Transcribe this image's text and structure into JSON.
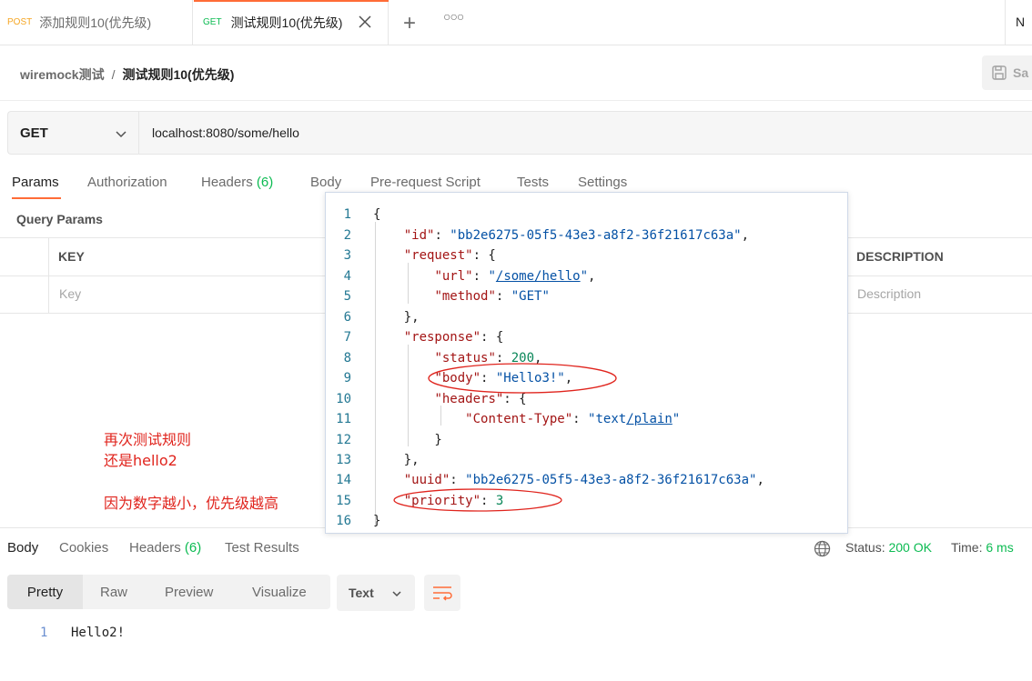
{
  "tabs": [
    {
      "method": "POST",
      "label": "添加规则10(优先级)"
    },
    {
      "method": "GET",
      "label": "测试规则10(优先级)"
    }
  ],
  "tab_right_letter": "N",
  "breadcrumb": {
    "parent": "wiremock测试",
    "separator": "/",
    "current": "测试规则10(优先级)"
  },
  "save_label": "Sa",
  "request": {
    "method": "GET",
    "url": "localhost:8080/some/hello"
  },
  "request_tabs": {
    "params": "Params",
    "authorization": "Authorization",
    "headers": "Headers",
    "headers_count": "(6)",
    "body": "Body",
    "prerequest": "Pre-request Script",
    "tests": "Tests",
    "settings": "Settings"
  },
  "query_params": {
    "title": "Query Params",
    "col_key": "KEY",
    "col_desc": "DESCRIPTION",
    "key_placeholder": "Key",
    "desc_placeholder": "Description"
  },
  "annotation": {
    "line1": "再次测试规则",
    "line2": "还是hello2",
    "line3": "因为数字越小，优先级越高"
  },
  "code_lines": [
    {
      "n": "1"
    },
    {
      "n": "2"
    },
    {
      "n": "3"
    },
    {
      "n": "4"
    },
    {
      "n": "5"
    },
    {
      "n": "6"
    },
    {
      "n": "7"
    },
    {
      "n": "8"
    },
    {
      "n": "9"
    },
    {
      "n": "10"
    },
    {
      "n": "11"
    },
    {
      "n": "12"
    },
    {
      "n": "13"
    },
    {
      "n": "14"
    },
    {
      "n": "15"
    },
    {
      "n": "16"
    }
  ],
  "code": {
    "id_key": "\"id\"",
    "id_val": "\"bb2e6275-05f5-43e3-a8f2-36f21617c63a\"",
    "request_key": "\"request\"",
    "url_key": "\"url\"",
    "url_val_q1": "\"",
    "url_val": "/some/hello",
    "url_val_q2": "\"",
    "method_key": "\"method\"",
    "method_val": "\"GET\"",
    "response_key": "\"response\"",
    "status_key": "\"status\"",
    "status_val": "200",
    "body_key": "\"body\"",
    "body_val": "\"Hello3!\"",
    "headers_key": "\"headers\"",
    "ct_key": "\"Content-Type\"",
    "ct_val_a": "\"text",
    "ct_val_b": "/plain",
    "ct_val_c": "\"",
    "uuid_key": "\"uuid\"",
    "uuid_val": "\"bb2e6275-05f5-43e3-a8f2-36f21617c63a\"",
    "priority_key": "\"priority\"",
    "priority_val": "3"
  },
  "response_tabs": {
    "body": "Body",
    "cookies": "Cookies",
    "headers": "Headers",
    "headers_count": "(6)",
    "test_results": "Test Results"
  },
  "status": {
    "label": "Status:",
    "value": "200 OK"
  },
  "time": {
    "label": "Time:",
    "value": "6 ms"
  },
  "view_modes": {
    "pretty": "Pretty",
    "raw": "Raw",
    "preview": "Preview",
    "visualize": "Visualize"
  },
  "format": "Text",
  "response_body": {
    "line_no": "1",
    "text": "Hello2!"
  },
  "colors": {
    "accent": "#ff6c37",
    "post": "#f5a623",
    "get": "#0cbb52",
    "annotation": "#e0241d"
  }
}
